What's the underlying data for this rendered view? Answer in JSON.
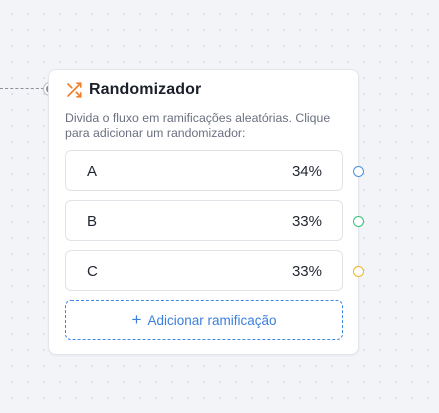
{
  "node": {
    "title": "Randomizador",
    "icon": "shuffle-icon",
    "icon_color": "#f07f2b",
    "description": "Divida o fluxo em ramificações aleatórias. Clique para adicionar um randomizador:"
  },
  "branches": [
    {
      "label": "A",
      "percent": "34%",
      "handle_color": "#4a90e2"
    },
    {
      "label": "B",
      "percent": "33%",
      "handle_color": "#34c17a"
    },
    {
      "label": "C",
      "percent": "33%",
      "handle_color": "#f0b429"
    }
  ],
  "add_branch": {
    "icon": "plus-icon",
    "icon_glyph": "+",
    "label": "Adicionar ramificação",
    "color": "#3a7fde"
  }
}
